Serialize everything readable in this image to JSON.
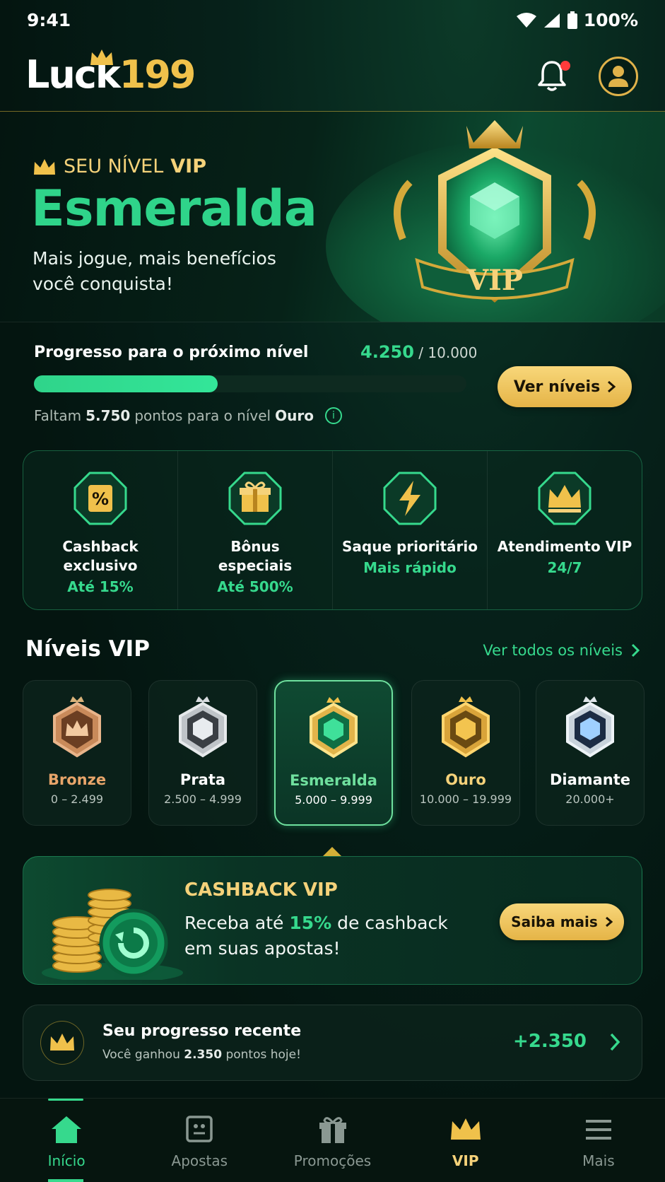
{
  "status_bar": {
    "time": "9:41",
    "battery": "100%"
  },
  "header": {
    "logo_text": "Luck",
    "logo_number": "199"
  },
  "hero": {
    "label_prefix": "SEU NÍVEL",
    "label_vip": "VIP",
    "level_name": "Esmeralda",
    "subtitle": "Mais jogue, mais benefícios você conquista!",
    "badge_text": "VIP"
  },
  "progress": {
    "label": "Progresso para o próximo nível",
    "current": "4.250",
    "separator": "/",
    "target": "10.000",
    "fraction": 0.425,
    "note_prefix": "Faltam",
    "note_points": "5.750",
    "note_middle": "pontos para o nível",
    "note_level": "Ouro",
    "button_label": "Ver níveis"
  },
  "benefits": [
    {
      "icon": "percent-icon",
      "title_line1": "Cashback",
      "title_line2": "exclusivo",
      "value": "Até 15%"
    },
    {
      "icon": "gift-icon",
      "title_line1": "Bônus",
      "title_line2": "especiais",
      "value": "Até 500%"
    },
    {
      "icon": "lightning-icon",
      "title_line1": "Saque prioritário",
      "title_line2": "",
      "value": "Mais rápido"
    },
    {
      "icon": "crown-icon",
      "title_line1": "Atendimento VIP",
      "title_line2": "",
      "value": "24/7"
    }
  ],
  "levels_section": {
    "title": "Níveis VIP",
    "link": "Ver todos os níveis",
    "levels": [
      {
        "name": "Bronze",
        "range": "0 – 2.499",
        "name_color": "#e8a56a"
      },
      {
        "name": "Prata",
        "range": "2.500 – 4.999",
        "name_color": "#ffffff"
      },
      {
        "name": "Esmeralda",
        "range": "5.000 – 9.999",
        "name_color": "#6fe09e"
      },
      {
        "name": "Ouro",
        "range": "10.000 – 19.999",
        "name_color": "#f5d27a"
      },
      {
        "name": "Diamante",
        "range": "20.000+",
        "name_color": "#ffffff"
      }
    ]
  },
  "cashback": {
    "title": "CASHBACK VIP",
    "text_prefix": "Receba até",
    "text_highlight": "15%",
    "text_suffix": "de cashback em suas apostas!",
    "button_label": "Saiba mais"
  },
  "recent": {
    "title": "Seu progresso recente",
    "sub_prefix": "Você ganhou",
    "sub_points": "2.350",
    "sub_suffix": "pontos hoje!",
    "value": "+2.350"
  },
  "nav": [
    {
      "label": "Início",
      "icon": "home-icon"
    },
    {
      "label": "Apostas",
      "icon": "ticket-icon"
    },
    {
      "label": "Promoções",
      "icon": "gift-icon"
    },
    {
      "label": "VIP",
      "icon": "crown-icon"
    },
    {
      "label": "Mais",
      "icon": "menu-icon"
    }
  ],
  "colors": {
    "accent_green": "#36d98d",
    "gold": "#f5d27a",
    "background": "#041510"
  }
}
